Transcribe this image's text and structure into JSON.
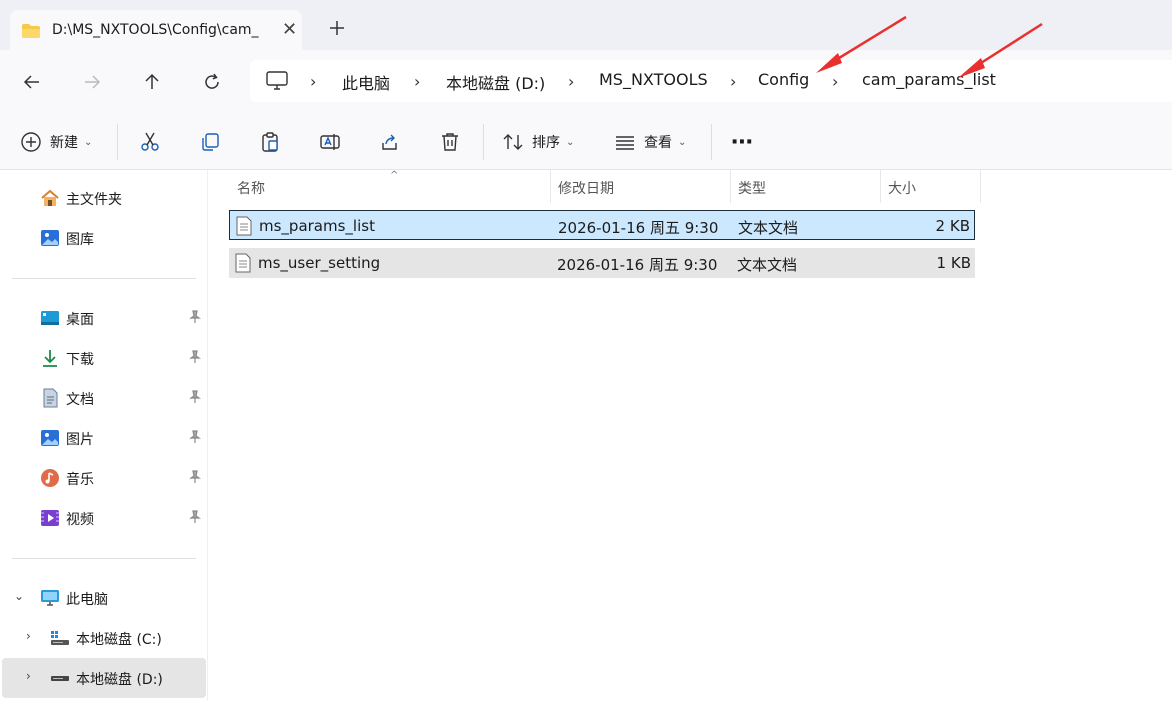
{
  "tab": {
    "title": "D:\\MS_NXTOOLS\\Config\\cam_",
    "close_glyph": "✕",
    "new_tab_glyph": "+"
  },
  "nav": {
    "back_glyph": "←",
    "forward_glyph": "→",
    "up_glyph": "↑",
    "refresh_glyph": "↻"
  },
  "breadcrumb": {
    "items": [
      "此电脑",
      "本地磁盘 (D:)",
      "MS_NXTOOLS",
      "Config",
      "cam_params_list"
    ],
    "separator": "›"
  },
  "commands": {
    "new_label": "新建",
    "sort_label": "排序",
    "view_label": "查看",
    "more_glyph": "⋯",
    "dropdown_glyph": "⌄"
  },
  "sidebar": {
    "home": "主文件夹",
    "gallery": "图库",
    "quick": [
      {
        "label": "桌面",
        "icon": "desktop-icon"
      },
      {
        "label": "下载",
        "icon": "download-icon"
      },
      {
        "label": "文档",
        "icon": "documents-icon"
      },
      {
        "label": "图片",
        "icon": "pictures-icon"
      },
      {
        "label": "音乐",
        "icon": "music-icon"
      },
      {
        "label": "视频",
        "icon": "videos-icon"
      }
    ],
    "this_pc": "此电脑",
    "drives": [
      "本地磁盘 (C:)",
      "本地磁盘 (D:)"
    ],
    "expand_glyph": "⌄",
    "collapse_glyph": "›"
  },
  "columns": {
    "name": "名称",
    "modified": "修改日期",
    "type": "类型",
    "size": "大小",
    "sort_glyph": "^"
  },
  "files": [
    {
      "name": "ms_params_list",
      "modified": "2026-01-16 周五 9:30",
      "type": "文本文档",
      "size": "2 KB",
      "state": "selected"
    },
    {
      "name": "ms_user_setting",
      "modified": "2026-01-16 周五 9:30",
      "type": "文本文档",
      "size": "1 KB",
      "state": "hover"
    }
  ],
  "colors": {
    "accent": "#0067c0",
    "selection": "#cce8ff",
    "annotation": "#e8312f"
  }
}
